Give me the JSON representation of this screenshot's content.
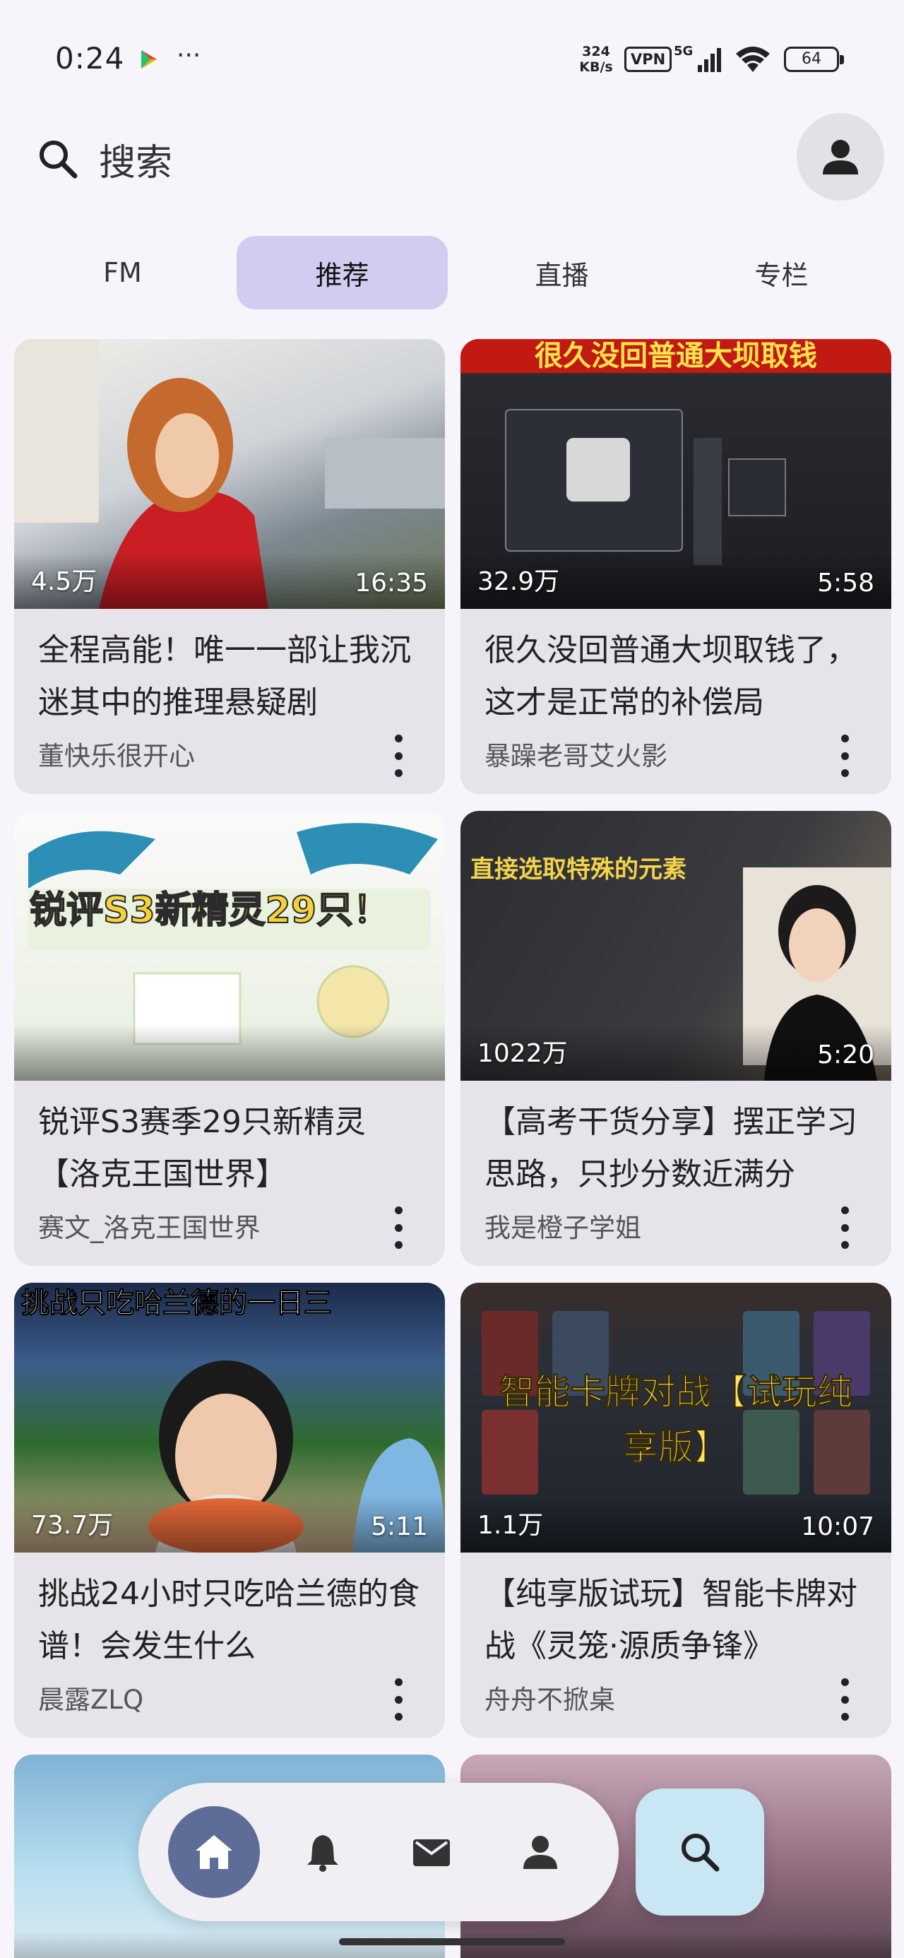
{
  "status_bar": {
    "time": "0:24",
    "more": "···",
    "net_speed_value": "324",
    "net_speed_unit": "KB/s",
    "vpn": "VPN",
    "network": "5G",
    "battery": "64"
  },
  "header": {
    "search_placeholder": "搜索"
  },
  "tabs": [
    {
      "label": "FM",
      "active": false
    },
    {
      "label": "推荐",
      "active": true
    },
    {
      "label": "直播",
      "active": false
    },
    {
      "label": "专栏",
      "active": false
    }
  ],
  "feed": [
    {
      "title": "全程高能！唯一一部让我沉迷其中的推理悬疑剧",
      "author": "董快乐很开心",
      "views": "4.5万",
      "duration": "16:35",
      "thumb_text": ""
    },
    {
      "title": "很久没回普通大坝取钱了，这才是正常的补偿局",
      "author": "暴躁老哥艾火影",
      "views": "32.9万",
      "duration": "5:58",
      "thumb_text": "很久没回普通大坝取钱"
    },
    {
      "title": "锐评S3赛季29只新精灵【洛克王国世界】",
      "author": "赛文_洛克王国世界",
      "views": "",
      "duration": "",
      "thumb_text": "锐评S3新精灵29只！"
    },
    {
      "title": "【高考干货分享】摆正学习思路，只抄分数近满分",
      "author": "我是橙子学姐",
      "views": "1022万",
      "duration": "5:20",
      "thumb_text": "直接选取特殊的元素"
    },
    {
      "title": "挑战24小时只吃哈兰德的食谱！会发生什么",
      "author": "晨露ZLQ",
      "views": "73.7万",
      "duration": "5:11",
      "thumb_text": "挑战只吃哈兰德的一日三"
    },
    {
      "title": "【纯享版试玩】智能卡牌对战《灵笼·源质争锋》",
      "author": "舟舟不掀桌",
      "views": "1.1万",
      "duration": "10:07",
      "thumb_text": "智能卡牌对战【试玩纯享版】"
    }
  ],
  "colors": {
    "accent_tab": "#d2cdf0",
    "nav_active": "#5e6c98",
    "nav_search": "#c8e6f3"
  },
  "icons": {
    "search": "search-icon",
    "avatar": "person-icon",
    "nav": [
      "home-icon",
      "bell-icon",
      "mail-icon",
      "person-icon",
      "search-icon"
    ]
  }
}
